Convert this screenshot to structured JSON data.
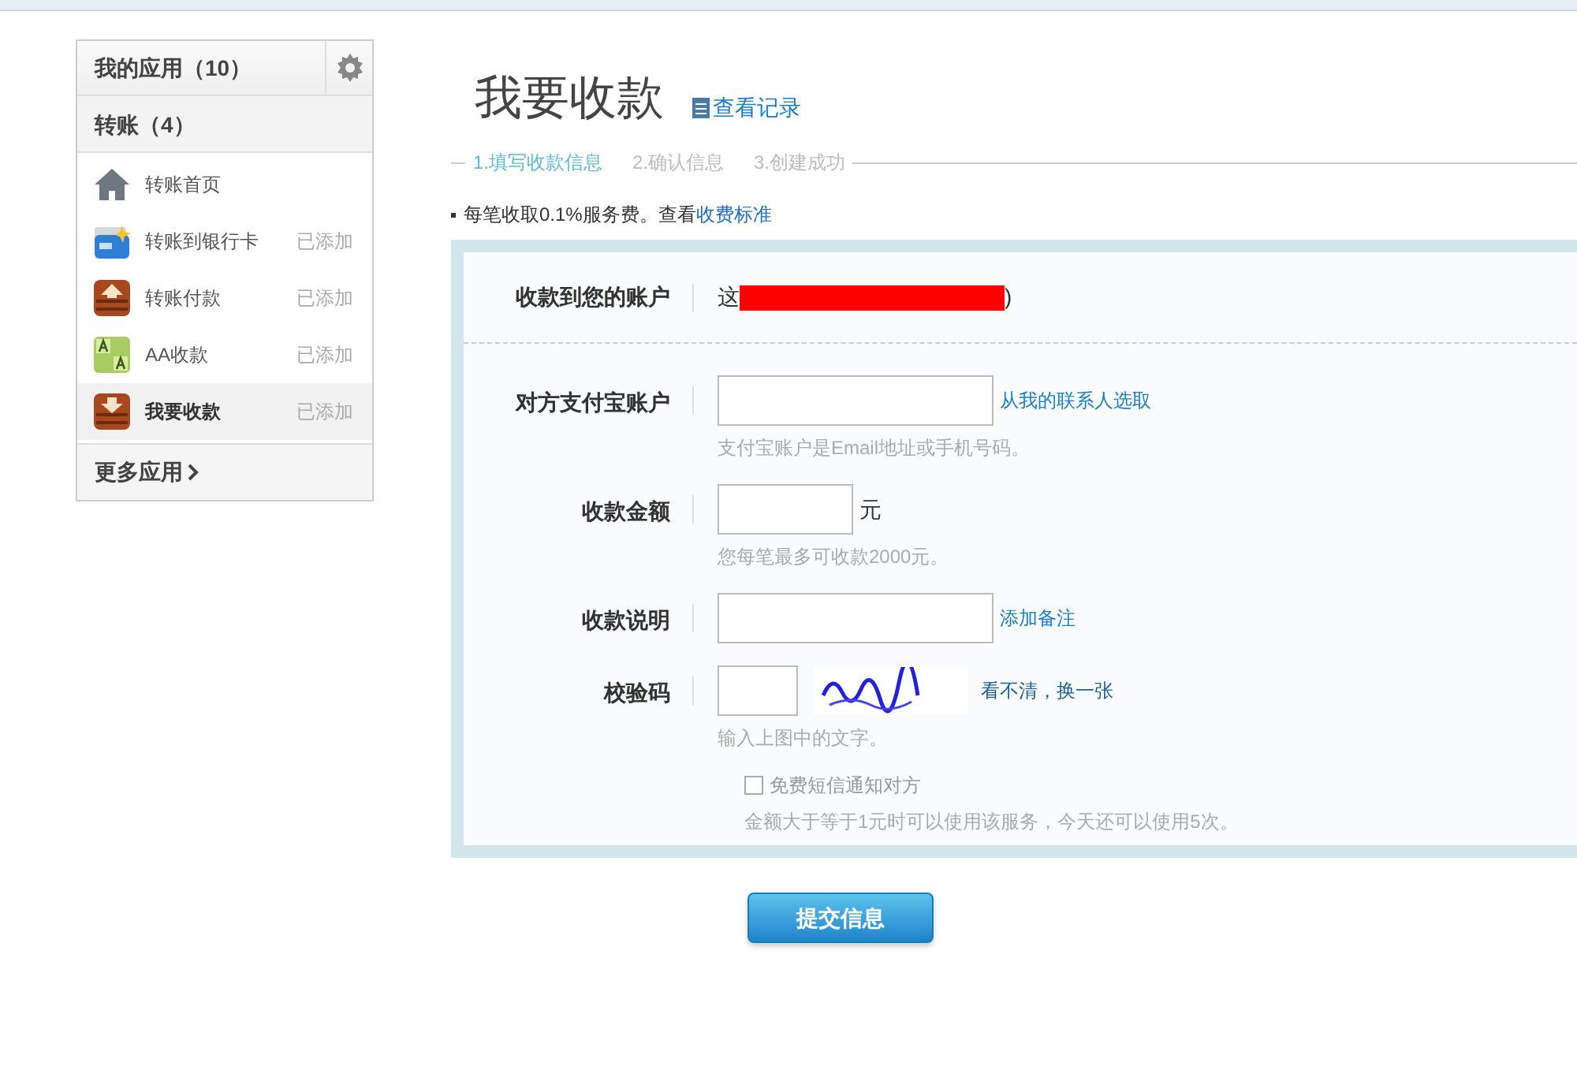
{
  "sidebar": {
    "header": "我的应用（10）",
    "group": "转账（4）",
    "items": [
      {
        "kind": "home",
        "label": "转账首页",
        "selected": false
      },
      {
        "kind": "bank",
        "label": "转账到银行卡",
        "status": "已添加",
        "selected": false
      },
      {
        "kind": "pay",
        "label": "转账付款",
        "status": "已添加",
        "selected": false
      },
      {
        "kind": "aa",
        "label": "AA收款",
        "status": "已添加",
        "selected": false
      },
      {
        "kind": "receive",
        "label": "我要收款",
        "status": "已添加",
        "selected": true
      }
    ],
    "more": "更多应用"
  },
  "page": {
    "title": "我要收款",
    "records_link": "查看记录",
    "steps": [
      {
        "label": "1.填写收款信息",
        "selected": true
      },
      {
        "label": "2.确认信息",
        "selected": false
      },
      {
        "label": "3.创建成功",
        "selected": false
      }
    ],
    "notice": "每笔收取0.1%服务费。查看",
    "notice_link": "收费标准"
  },
  "form": {
    "account": {
      "label": "收款到您的账户",
      "value_start": "这",
      "value_end": ")"
    },
    "rows": [
      {
        "kind": "text",
        "label": "对方支付宝账户",
        "link": "从我的联系人选取",
        "hint": "支付宝账户是Email地址或手机号码。"
      },
      {
        "kind": "amount",
        "label": "收款金额",
        "unit": "元",
        "hint": "您每笔最多可收款2000元。"
      },
      {
        "kind": "text",
        "label": "收款说明",
        "link": "添加备注"
      },
      {
        "kind": "captcha",
        "label": "校验码",
        "link": "看不清，换一张",
        "hint": "输入上图中的文字。"
      }
    ],
    "sms": {
      "label": "免费短信通知对方",
      "checked": false,
      "hint": "金额大于等于1元时可以使用该服务，今天还可以使用5次。"
    },
    "submit": "提交信息"
  }
}
